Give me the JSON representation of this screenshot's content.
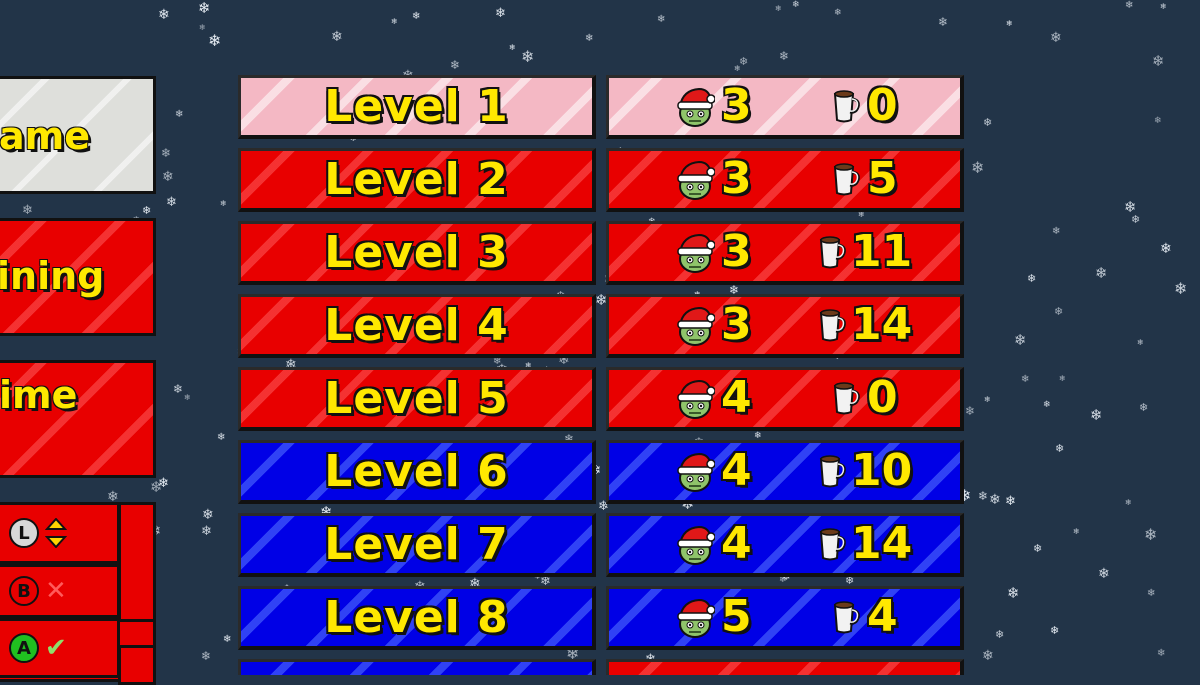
{
  "side_menu": {
    "items": [
      {
        "label": "ame",
        "style": "white"
      },
      {
        "label": "ining",
        "style": "red"
      },
      {
        "label": "ime",
        "style": "red"
      }
    ],
    "controls": [
      {
        "button": "L",
        "icon": "dpad-updown-icon"
      },
      {
        "button": "B",
        "mark": "✕"
      },
      {
        "button": "A",
        "mark": "✔"
      }
    ]
  },
  "levels": [
    {
      "name": "Level 1",
      "zombies": "3",
      "coffee": "0",
      "color": "pink"
    },
    {
      "name": "Level 2",
      "zombies": "3",
      "coffee": "5",
      "color": "red"
    },
    {
      "name": "Level 3",
      "zombies": "3",
      "coffee": "11",
      "color": "red"
    },
    {
      "name": "Level 4",
      "zombies": "3",
      "coffee": "14",
      "color": "red"
    },
    {
      "name": "Level 5",
      "zombies": "4",
      "coffee": "0",
      "color": "red"
    },
    {
      "name": "Level 6",
      "zombies": "4",
      "coffee": "10",
      "color": "blue"
    },
    {
      "name": "Level 7",
      "zombies": "4",
      "coffee": "14",
      "color": "blue"
    },
    {
      "name": "Level 8",
      "zombies": "5",
      "coffee": "4",
      "color": "blue"
    }
  ],
  "colors": {
    "background": "#223448",
    "red": "#e80000",
    "blue": "#0000e6",
    "pink": "#f4b8c4",
    "text": "#ffe800"
  },
  "icons": {
    "zombie": "zombie-santa-hat-icon",
    "coffee": "coffee-mug-icon"
  }
}
